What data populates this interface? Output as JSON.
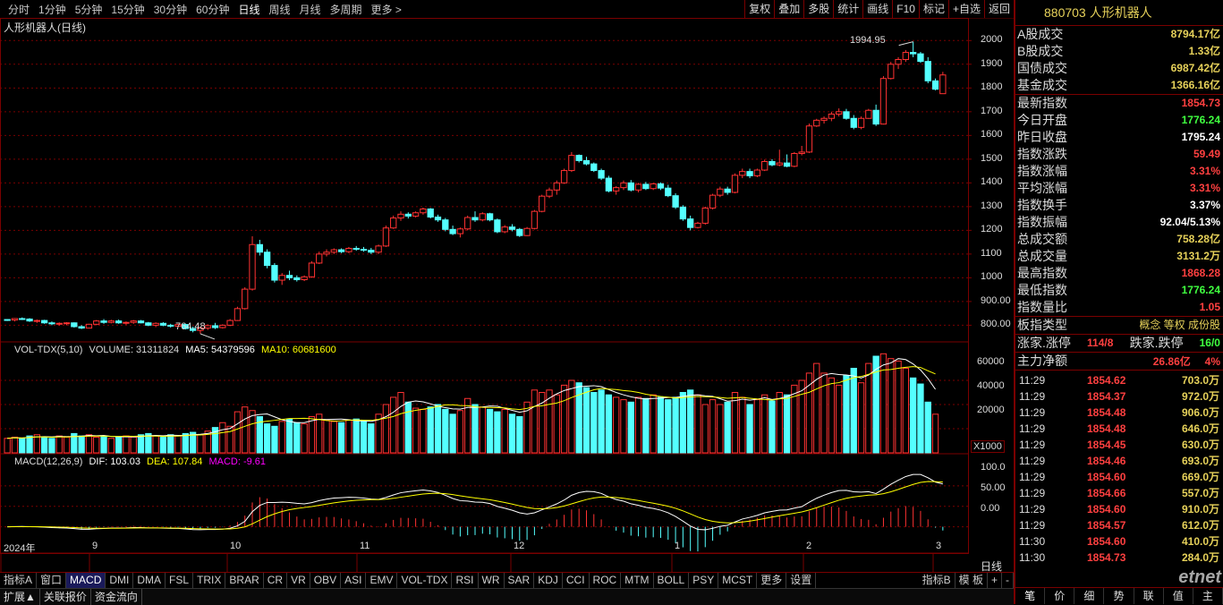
{
  "toolbar": {
    "periods": [
      "分时",
      "1分钟",
      "5分钟",
      "15分钟",
      "30分钟",
      "60分钟",
      "日线",
      "周线",
      "月线",
      "多周期",
      "更多 >"
    ],
    "active_period": "日线",
    "tools": [
      "复权",
      "叠加",
      "多股",
      "统计",
      "画线",
      "F10",
      "标记",
      "+自选",
      "返回"
    ]
  },
  "chart": {
    "title": "人形机器人(日线)",
    "price_ticks": [
      "2000",
      "1900",
      "1800",
      "1700",
      "1600",
      "1500",
      "1400",
      "1300",
      "1200",
      "1100",
      "1000",
      "900.00",
      "800.00"
    ],
    "high_label": "1994.95",
    "low_label": "764.48",
    "vol_legend": {
      "name": "VOL-TDX(5,10)",
      "volume": "VOLUME: 31311824",
      "ma5": "MA5: 54379596",
      "ma10": "MA10: 60681600"
    },
    "vol_ticks": [
      "60000",
      "40000",
      "20000"
    ],
    "vol_unit": "X1000",
    "macd_legend": {
      "name": "MACD(12,26,9)",
      "dif": "DIF: 103.03",
      "dea": "DEA: 107.84",
      "macd": "MACD: -9.61"
    },
    "macd_ticks": [
      "100.0",
      "50.00",
      "0.00"
    ],
    "date_labels": [
      "2024年",
      "9",
      "10",
      "11",
      "12",
      "1",
      "2",
      "3"
    ],
    "colors": {
      "up": "#ff3232",
      "down": "#54ffff",
      "ma5": "#ffffff",
      "ma10": "#ffff00",
      "grid": "#7a0000",
      "macd_text": "#ff00ff"
    }
  },
  "indicator_bar": {
    "items": [
      "指标A",
      "窗口",
      "MACD",
      "DMI",
      "DMA",
      "FSL",
      "TRIX",
      "BRAR",
      "CR",
      "VR",
      "OBV",
      "ASI",
      "EMV",
      "VOL-TDX",
      "RSI",
      "WR",
      "SAR",
      "KDJ",
      "CCI",
      "ROC",
      "MTM",
      "BOLL",
      "PSY",
      "MCST",
      "更多",
      "设置"
    ],
    "active": "MACD",
    "right": [
      "指标B",
      "模 板",
      "+",
      "-"
    ],
    "line_label": "日线"
  },
  "bottom_tabs": [
    "扩展▲",
    "关联报价",
    "资金流向"
  ],
  "panel": {
    "code": "880703",
    "name": "人形机器人",
    "market_rows": [
      {
        "k": "A股成交",
        "v": "8794.17亿",
        "c": "#e6d15a"
      },
      {
        "k": "B股成交",
        "v": "1.33亿",
        "c": "#e6d15a"
      },
      {
        "k": "国债成交",
        "v": "6987.42亿",
        "c": "#e6d15a"
      },
      {
        "k": "基金成交",
        "v": "1366.16亿",
        "c": "#e6d15a"
      }
    ],
    "index_rows": [
      {
        "k": "最新指数",
        "v": "1854.73",
        "c": "#ff4040"
      },
      {
        "k": "今日开盘",
        "v": "1776.24",
        "c": "#40ff40"
      },
      {
        "k": "昨日收盘",
        "v": "1795.24",
        "c": "#ffffff"
      },
      {
        "k": "指数涨跌",
        "v": "59.49",
        "c": "#ff4040"
      },
      {
        "k": "指数涨幅",
        "v": "3.31%",
        "c": "#ff4040"
      },
      {
        "k": "平均涨幅",
        "v": "3.31%",
        "c": "#ff4040"
      },
      {
        "k": "指数换手",
        "v": "3.37%",
        "c": "#ffffff"
      },
      {
        "k": "指数振幅",
        "v": "92.04/5.13%",
        "c": "#ffffff"
      },
      {
        "k": "总成交额",
        "v": "758.28亿",
        "c": "#e6d15a"
      },
      {
        "k": "总成交量",
        "v": "3131.2万",
        "c": "#e6d15a"
      },
      {
        "k": "最高指数",
        "v": "1868.28",
        "c": "#ff4040"
      },
      {
        "k": "最低指数",
        "v": "1776.24",
        "c": "#40ff40"
      },
      {
        "k": "指数量比",
        "v": "1.05",
        "c": "#ff4040"
      }
    ],
    "type_row": {
      "k": "板指类型",
      "v": "概念 等权 成份股"
    },
    "rise_row": {
      "k1": "涨家.涨停",
      "v1": "114/8",
      "k2": "跌家.跌停",
      "v2": "16/0"
    },
    "flow_row": {
      "k": "主力净额",
      "v": "26.86亿",
      "pct": "4%"
    },
    "ticks": [
      {
        "t": "11:29",
        "p": "1854.62",
        "q": "703.0万"
      },
      {
        "t": "11:29",
        "p": "1854.37",
        "q": "972.0万"
      },
      {
        "t": "11:29",
        "p": "1854.48",
        "q": "906.0万"
      },
      {
        "t": "11:29",
        "p": "1854.48",
        "q": "646.0万"
      },
      {
        "t": "11:29",
        "p": "1854.45",
        "q": "630.0万"
      },
      {
        "t": "11:29",
        "p": "1854.46",
        "q": "693.0万"
      },
      {
        "t": "11:29",
        "p": "1854.60",
        "q": "669.0万"
      },
      {
        "t": "11:29",
        "p": "1854.66",
        "q": "557.0万"
      },
      {
        "t": "11:29",
        "p": "1854.60",
        "q": "910.0万"
      },
      {
        "t": "11:29",
        "p": "1854.57",
        "q": "612.0万"
      },
      {
        "t": "11:30",
        "p": "1854.60",
        "q": "410.0万"
      },
      {
        "t": "11:30",
        "p": "1854.73",
        "q": "284.0万"
      }
    ],
    "tabs": [
      "笔",
      "价",
      "细",
      "势",
      "联",
      "值",
      "主"
    ],
    "watermark": "etnet"
  },
  "chart_data": {
    "type": "candlestick",
    "title": "人形机器人(日线)",
    "ylim": [
      760,
      2020
    ],
    "candles": [
      [
        824,
        826,
        818,
        822
      ],
      [
        822,
        830,
        816,
        828
      ],
      [
        828,
        833,
        822,
        826
      ],
      [
        826,
        830,
        814,
        818
      ],
      [
        818,
        824,
        810,
        820
      ],
      [
        820,
        823,
        806,
        810
      ],
      [
        810,
        816,
        800,
        806
      ],
      [
        806,
        812,
        798,
        808
      ],
      [
        808,
        813,
        800,
        810
      ],
      [
        810,
        812,
        790,
        794
      ],
      [
        794,
        800,
        784,
        788
      ],
      [
        788,
        806,
        786,
        804
      ],
      [
        804,
        822,
        800,
        818
      ],
      [
        818,
        826,
        806,
        812
      ],
      [
        812,
        823,
        808,
        818
      ],
      [
        818,
        824,
        806,
        810
      ],
      [
        810,
        816,
        802,
        812
      ],
      [
        812,
        822,
        806,
        818
      ],
      [
        818,
        822,
        808,
        810
      ],
      [
        810,
        814,
        796,
        800
      ],
      [
        800,
        812,
        792,
        808
      ],
      [
        808,
        813,
        796,
        800
      ],
      [
        800,
        806,
        790,
        796
      ],
      [
        796,
        806,
        790,
        803
      ],
      [
        803,
        806,
        782,
        786
      ],
      [
        786,
        794,
        770,
        778
      ],
      [
        778,
        792,
        764,
        788
      ],
      [
        788,
        804,
        780,
        798
      ],
      [
        798,
        810,
        784,
        790
      ],
      [
        790,
        804,
        786,
        800
      ],
      [
        800,
        826,
        796,
        820
      ],
      [
        820,
        878,
        818,
        870
      ],
      [
        870,
        960,
        866,
        952
      ],
      [
        952,
        1175,
        946,
        1140
      ],
      [
        1140,
        1160,
        1094,
        1108
      ],
      [
        1108,
        1120,
        1040,
        1052
      ],
      [
        1052,
        1062,
        980,
        990
      ],
      [
        990,
        1020,
        970,
        1010
      ],
      [
        1010,
        1030,
        990,
        1000
      ],
      [
        1000,
        1010,
        984,
        992
      ],
      [
        992,
        1010,
        986,
        1004
      ],
      [
        1004,
        1070,
        1000,
        1062
      ],
      [
        1062,
        1110,
        1058,
        1100
      ],
      [
        1100,
        1120,
        1090,
        1108
      ],
      [
        1108,
        1124,
        1100,
        1118
      ],
      [
        1118,
        1124,
        1104,
        1110
      ],
      [
        1110,
        1130,
        1104,
        1124
      ],
      [
        1124,
        1134,
        1114,
        1120
      ],
      [
        1120,
        1130,
        1110,
        1116
      ],
      [
        1116,
        1126,
        1100,
        1108
      ],
      [
        1108,
        1140,
        1100,
        1134
      ],
      [
        1134,
        1220,
        1130,
        1210
      ],
      [
        1210,
        1262,
        1206,
        1252
      ],
      [
        1252,
        1280,
        1240,
        1268
      ],
      [
        1268,
        1276,
        1250,
        1260
      ],
      [
        1260,
        1280,
        1254,
        1274
      ],
      [
        1274,
        1296,
        1266,
        1290
      ],
      [
        1290,
        1294,
        1250,
        1256
      ],
      [
        1256,
        1266,
        1236,
        1244
      ],
      [
        1244,
        1252,
        1196,
        1204
      ],
      [
        1204,
        1220,
        1180,
        1186
      ],
      [
        1186,
        1212,
        1170,
        1206
      ],
      [
        1206,
        1262,
        1200,
        1254
      ],
      [
        1254,
        1280,
        1236,
        1244
      ],
      [
        1244,
        1276,
        1238,
        1270
      ],
      [
        1270,
        1274,
        1238,
        1244
      ],
      [
        1244,
        1250,
        1188,
        1194
      ],
      [
        1194,
        1222,
        1188,
        1214
      ],
      [
        1214,
        1226,
        1196,
        1204
      ],
      [
        1204,
        1210,
        1172,
        1178
      ],
      [
        1178,
        1214,
        1176,
        1208
      ],
      [
        1208,
        1286,
        1204,
        1280
      ],
      [
        1280,
        1350,
        1276,
        1344
      ],
      [
        1344,
        1380,
        1336,
        1370
      ],
      [
        1370,
        1410,
        1350,
        1400
      ],
      [
        1400,
        1460,
        1396,
        1452
      ],
      [
        1452,
        1530,
        1446,
        1516
      ],
      [
        1516,
        1520,
        1486,
        1494
      ],
      [
        1494,
        1510,
        1474,
        1480
      ],
      [
        1480,
        1486,
        1446,
        1452
      ],
      [
        1452,
        1460,
        1412,
        1420
      ],
      [
        1420,
        1430,
        1360,
        1366
      ],
      [
        1366,
        1386,
        1350,
        1380
      ],
      [
        1380,
        1410,
        1370,
        1400
      ],
      [
        1400,
        1412,
        1364,
        1370
      ],
      [
        1370,
        1400,
        1360,
        1394
      ],
      [
        1394,
        1404,
        1370,
        1376
      ],
      [
        1376,
        1400,
        1370,
        1396
      ],
      [
        1396,
        1402,
        1370,
        1378
      ],
      [
        1378,
        1392,
        1340,
        1346
      ],
      [
        1346,
        1356,
        1290,
        1298
      ],
      [
        1298,
        1306,
        1240,
        1248
      ],
      [
        1248,
        1262,
        1200,
        1212
      ],
      [
        1212,
        1236,
        1208,
        1230
      ],
      [
        1230,
        1300,
        1224,
        1294
      ],
      [
        1294,
        1354,
        1288,
        1348
      ],
      [
        1348,
        1384,
        1340,
        1374
      ],
      [
        1374,
        1384,
        1350,
        1360
      ],
      [
        1360,
        1440,
        1356,
        1432
      ],
      [
        1432,
        1460,
        1420,
        1448
      ],
      [
        1448,
        1460,
        1420,
        1430
      ],
      [
        1430,
        1460,
        1424,
        1454
      ],
      [
        1454,
        1498,
        1450,
        1490
      ],
      [
        1490,
        1500,
        1470,
        1476
      ],
      [
        1476,
        1540,
        1470,
        1484
      ],
      [
        1484,
        1520,
        1466,
        1470
      ],
      [
        1470,
        1530,
        1466,
        1524
      ],
      [
        1524,
        1556,
        1516,
        1530
      ],
      [
        1530,
        1650,
        1526,
        1640
      ],
      [
        1640,
        1670,
        1636,
        1664
      ],
      [
        1664,
        1680,
        1650,
        1672
      ],
      [
        1672,
        1700,
        1660,
        1690
      ],
      [
        1690,
        1714,
        1680,
        1700
      ],
      [
        1700,
        1712,
        1666,
        1672
      ],
      [
        1672,
        1686,
        1626,
        1634
      ],
      [
        1634,
        1680,
        1626,
        1672
      ],
      [
        1672,
        1712,
        1670,
        1706
      ],
      [
        1706,
        1730,
        1640,
        1648
      ],
      [
        1648,
        1850,
        1646,
        1840
      ],
      [
        1840,
        1910,
        1836,
        1900
      ],
      [
        1900,
        1930,
        1880,
        1920
      ],
      [
        1920,
        1960,
        1910,
        1950
      ],
      [
        1950,
        1995,
        1930,
        1944
      ],
      [
        1944,
        1952,
        1906,
        1912
      ],
      [
        1912,
        1930,
        1820,
        1830
      ],
      [
        1830,
        1840,
        1790,
        1795
      ],
      [
        1776,
        1868,
        1776,
        1855
      ]
    ],
    "volume": [
      12,
      13,
      12,
      14,
      15,
      13,
      12,
      14,
      13,
      16,
      14,
      15,
      13,
      14,
      12,
      13,
      14,
      13,
      15,
      16,
      14,
      13,
      15,
      14,
      16,
      17,
      15,
      18,
      21,
      25,
      22,
      34,
      38,
      35,
      30,
      24,
      22,
      26,
      28,
      25,
      24,
      30,
      32,
      27,
      26,
      25,
      27,
      28,
      26,
      24,
      32,
      40,
      46,
      50,
      42,
      37,
      36,
      38,
      40,
      36,
      32,
      35,
      45,
      40,
      38,
      36,
      34,
      36,
      32,
      30,
      42,
      52,
      50,
      52,
      48,
      56,
      60,
      58,
      54,
      50,
      52,
      48,
      46,
      44,
      42,
      46,
      45,
      48,
      46,
      44,
      46,
      50,
      52,
      48,
      40,
      44,
      40,
      42,
      50,
      46,
      40,
      44,
      48,
      43,
      50,
      48,
      56,
      60,
      66,
      74,
      66,
      62,
      56,
      64,
      70,
      58,
      74,
      80,
      82,
      78,
      76,
      70,
      62,
      57,
      42,
      32
    ],
    "volume_up": [
      1,
      1,
      0,
      0,
      1,
      0,
      0,
      1,
      1,
      0,
      0,
      1,
      1,
      0,
      1,
      0,
      1,
      1,
      0,
      0,
      1,
      0,
      0,
      1,
      0,
      0,
      1,
      1,
      0,
      1,
      1,
      1,
      1,
      1,
      0,
      0,
      0,
      1,
      0,
      0,
      1,
      1,
      1,
      1,
      1,
      0,
      1,
      0,
      0,
      0,
      1,
      1,
      1,
      1,
      0,
      1,
      1,
      0,
      0,
      0,
      0,
      1,
      1,
      0,
      1,
      0,
      0,
      1,
      0,
      0,
      1,
      1,
      1,
      1,
      1,
      1,
      1,
      0,
      0,
      0,
      0,
      0,
      1,
      1,
      0,
      1,
      0,
      1,
      0,
      0,
      0,
      0,
      0,
      1,
      1,
      1,
      1,
      0,
      1,
      1,
      0,
      1,
      1,
      0,
      1,
      0,
      1,
      1,
      1,
      1,
      1,
      1,
      1,
      0,
      0,
      1,
      1,
      0,
      1,
      1,
      1,
      1,
      0,
      0,
      0,
      1
    ],
    "macd": {
      "dif_last": 103.03,
      "dea_last": 107.84,
      "macd_last": -9.61,
      "ylim": [
        -60,
        150
      ]
    }
  }
}
